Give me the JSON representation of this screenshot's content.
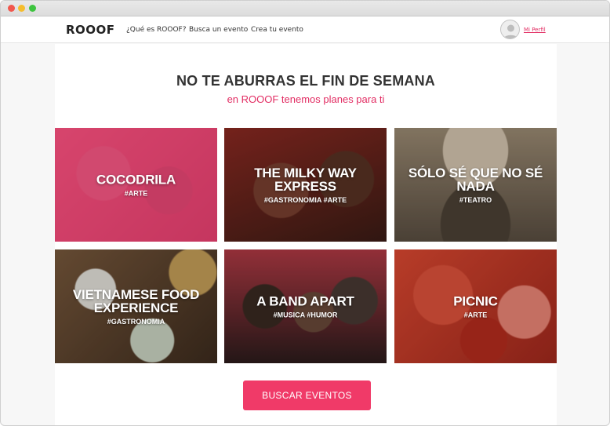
{
  "nav": {
    "logo": "ROOOF",
    "links": [
      "¿Qué es ROOOF?",
      "Busca un evento",
      "Crea tu evento"
    ],
    "profile_label": "Mi Perfil"
  },
  "hero": {
    "headline": "NO TE ABURRAS EL FIN DE SEMANA",
    "subheadline": "en ROOOF tenemos planes para ti"
  },
  "events": [
    {
      "title": "COCODRILA",
      "tags": "#ARTE"
    },
    {
      "title": "THE MILKY WAY EXPRESS",
      "tags": "#GASTRONOMIA #ARTE"
    },
    {
      "title": "SÓLO SÉ QUE NO SÉ NADA",
      "tags": "#TEATRO"
    },
    {
      "title": "VIETNAMESE FOOD EXPERIENCE",
      "tags": "#GASTRONOMIA"
    },
    {
      "title": "A BAND APART",
      "tags": "#MUSICA #HUMOR"
    },
    {
      "title": "PICNIC",
      "tags": "#ARTE"
    }
  ],
  "cta": {
    "label": "BUSCAR EVENTOS"
  },
  "colors": {
    "accent": "#e22d63",
    "button": "#f03a68"
  }
}
